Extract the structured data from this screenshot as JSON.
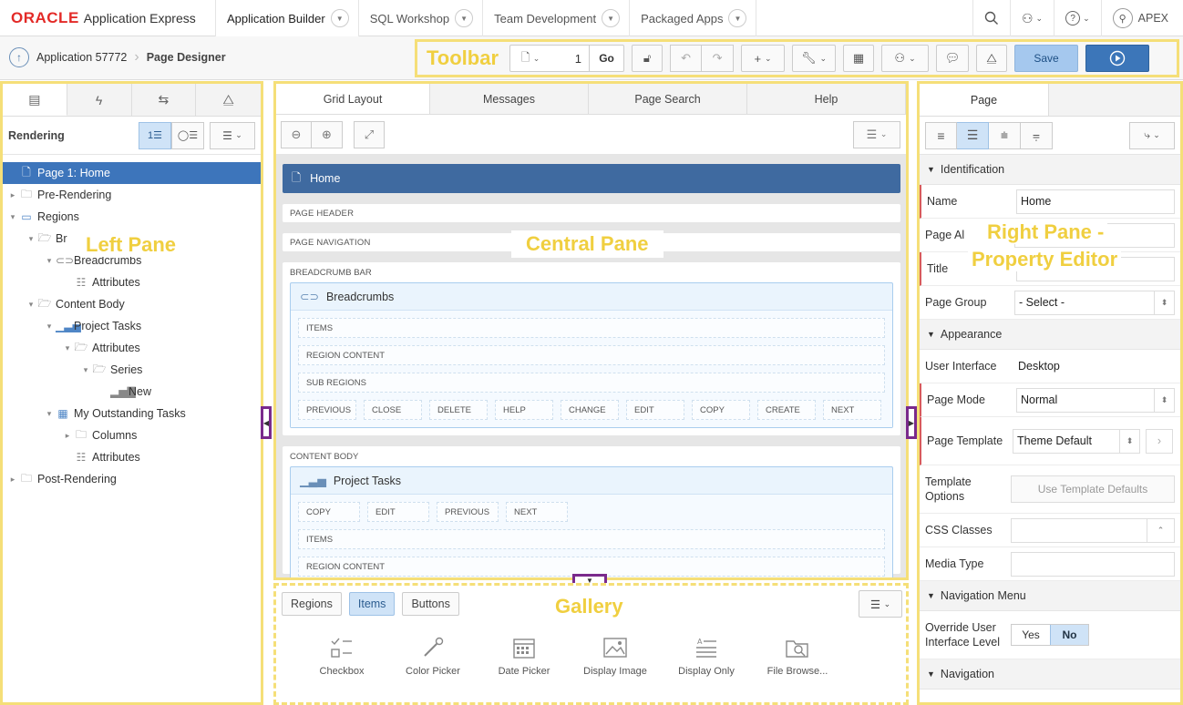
{
  "brand": {
    "oracle": "ORACLE",
    "product": "Application Express"
  },
  "nav": {
    "tabs": [
      {
        "label": "Application Builder"
      },
      {
        "label": "SQL Workshop"
      },
      {
        "label": "Team Development"
      },
      {
        "label": "Packaged Apps"
      }
    ],
    "user": "APEX"
  },
  "breadcrumb": {
    "app": "Application 57772",
    "current": "Page Designer"
  },
  "toolbar": {
    "label": "Toolbar",
    "page_number": "1",
    "go_label": "Go",
    "save_label": "Save"
  },
  "left": {
    "label": "Left Pane",
    "heading": "Rendering",
    "tree": [
      {
        "text": "Page 1: Home",
        "level": 0,
        "toggle": "",
        "icon": "page-icon"
      },
      {
        "text": "Pre-Rendering",
        "level": 0,
        "toggle": "▸",
        "icon": "folder-icon"
      },
      {
        "text": "Regions",
        "level": 0,
        "toggle": "▾",
        "icon": "region-icon"
      },
      {
        "text": "Br",
        "level": 1,
        "toggle": "▾",
        "icon": "folder-open-icon"
      },
      {
        "text": "Breadcrumbs",
        "level": 2,
        "toggle": "▾",
        "icon": "breadcrumb-icon"
      },
      {
        "text": "Attributes",
        "level": 3,
        "toggle": "",
        "icon": "list-icon"
      },
      {
        "text": "Content Body",
        "level": 1,
        "toggle": "▾",
        "icon": "folder-open-icon"
      },
      {
        "text": "Project Tasks",
        "level": 2,
        "toggle": "▾",
        "icon": "chart-icon"
      },
      {
        "text": "Attributes",
        "level": 3,
        "toggle": "▾",
        "icon": "folder-open-icon"
      },
      {
        "text": "Series",
        "level": 4,
        "toggle": "▾",
        "icon": "folder-open-icon"
      },
      {
        "text": "New",
        "level": 5,
        "toggle": "",
        "icon": "bar-chart-icon"
      },
      {
        "text": "My Outstanding Tasks",
        "level": 2,
        "toggle": "▾",
        "icon": "table-icon"
      },
      {
        "text": "Columns",
        "level": 3,
        "toggle": "▸",
        "icon": "folder-icon"
      },
      {
        "text": "Attributes",
        "level": 3,
        "toggle": "",
        "icon": "list-icon"
      },
      {
        "text": "Post-Rendering",
        "level": 0,
        "toggle": "▸",
        "icon": "folder-icon"
      }
    ]
  },
  "center": {
    "label": "Central Pane",
    "tabs": [
      "Grid Layout",
      "Messages",
      "Page Search",
      "Help"
    ],
    "page_title": "Home",
    "slots": {
      "page_header": "PAGE HEADER",
      "page_navigation": "PAGE NAVIGATION"
    },
    "breadcrumb_bar": {
      "title": "BREADCRUMB BAR",
      "region": "Breadcrumbs",
      "positions": [
        "ITEMS",
        "REGION CONTENT",
        "SUB REGIONS"
      ],
      "buttons": [
        "PREVIOUS",
        "CLOSE",
        "DELETE",
        "HELP",
        "CHANGE",
        "EDIT",
        "COPY",
        "CREATE",
        "NEXT"
      ]
    },
    "content_body": {
      "title": "CONTENT BODY",
      "region": "Project Tasks",
      "buttons": [
        "COPY",
        "EDIT",
        "PREVIOUS",
        "NEXT"
      ],
      "positions": [
        "ITEMS",
        "REGION CONTENT"
      ]
    }
  },
  "gallery": {
    "label": "Gallery",
    "tabs": [
      "Regions",
      "Items",
      "Buttons"
    ],
    "items": [
      "Checkbox",
      "Color Picker",
      "Date Picker",
      "Display Image",
      "Display Only",
      "File Browse..."
    ]
  },
  "right": {
    "label_line1": "Right Pane -",
    "label_line2": "Property Editor",
    "tab": "Page",
    "groups": {
      "identification": "Identification",
      "appearance": "Appearance",
      "navigation_menu": "Navigation Menu",
      "navigation": "Navigation"
    },
    "props": {
      "name_label": "Name",
      "name_value": "Home",
      "alias_label": "Page Al",
      "title_label": "Title",
      "group_label": "Page Group",
      "group_value": "- Select -",
      "ui_label": "User Interface",
      "ui_value": "Desktop",
      "mode_label": "Page Mode",
      "mode_value": "Normal",
      "template_label": "Page Template",
      "template_value": "Theme Default",
      "options_label": "Template Options",
      "options_button": "Use Template Defaults",
      "css_label": "CSS Classes",
      "media_label": "Media Type",
      "override_label": "Override User Interface Level",
      "yes": "Yes",
      "no": "No"
    }
  },
  "colors": {
    "accent": "#3d75bb",
    "highlight": "#f5df78",
    "splitter": "#7a2a8c",
    "brand": "#e32a27"
  }
}
